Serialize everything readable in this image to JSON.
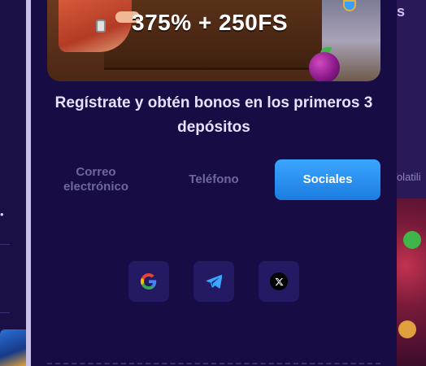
{
  "background": {
    "right_partial_text": "s",
    "right_partial_label": "Volatili"
  },
  "banner": {
    "promo_text": "375% + 250FS"
  },
  "headline": "Regístrate y obtén bonos en los primeros 3 depósitos",
  "tabs": [
    {
      "label": "Correo electrónico",
      "active": false
    },
    {
      "label": "Teléfono",
      "active": false
    },
    {
      "label": "Sociales",
      "active": true
    }
  ],
  "social_buttons": [
    {
      "icon": "google-icon"
    },
    {
      "icon": "telegram-icon"
    },
    {
      "icon": "x-icon"
    }
  ],
  "colors": {
    "modal_bg": "#170d44",
    "active_tab": "#2a91f5",
    "inactive_tab_text": "#6e679a",
    "social_btn_bg": "#231a63"
  }
}
